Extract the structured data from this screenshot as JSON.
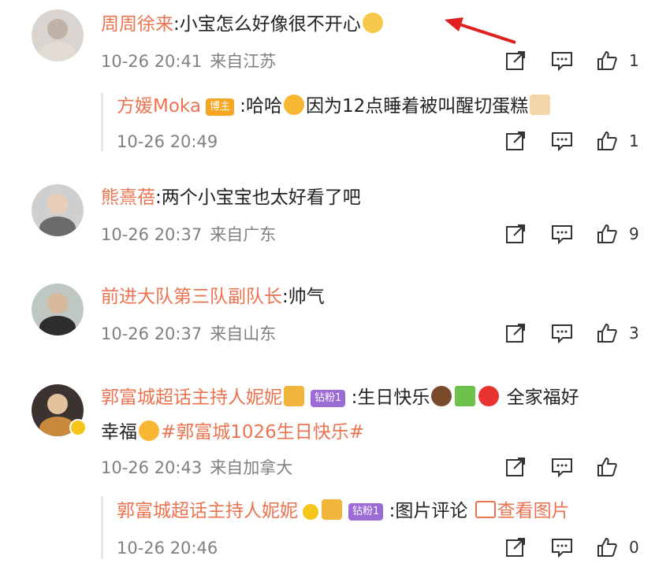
{
  "comments": [
    {
      "user": "周周徐来",
      "text": ":小宝怎么好像很不开心",
      "date": "10-26 20:41",
      "location": "来自江苏",
      "likes": "1",
      "reply": {
        "user": "方媛Moka",
        "badge": "博主",
        "text_a": ":哈哈",
        "text_b": "因为12点睡着被叫醒切蛋糕",
        "date": "10-26 20:49",
        "likes": "1"
      }
    },
    {
      "user": "熊熹蓓",
      "text": ":两个小宝宝也太好看了吧",
      "date": "10-26 20:37",
      "location": "来自广东",
      "likes": "9"
    },
    {
      "user": "前进大队第三队副队长",
      "text": ":帅气",
      "date": "10-26 20:37",
      "location": "来自山东",
      "likes": "3"
    },
    {
      "user": "郭富城超话主持人妮妮",
      "badge": "钻粉1",
      "text_a": ":生日快乐",
      "text_b": "全家福好",
      "text_c": "幸福",
      "topic": "#郭富城1026生日快乐#",
      "date": "10-26 20:43",
      "location": "来自加拿大",
      "likes": "",
      "reply": {
        "user": "郭富城超话主持人妮妮",
        "badge": "钻粉1",
        "text": ":图片评论",
        "pic_link": "查看图片",
        "date": "10-26 20:46",
        "likes": "0"
      }
    }
  ],
  "colors": {
    "name": "#eb7350",
    "meta": "#808080",
    "arrow": "#e02020"
  }
}
